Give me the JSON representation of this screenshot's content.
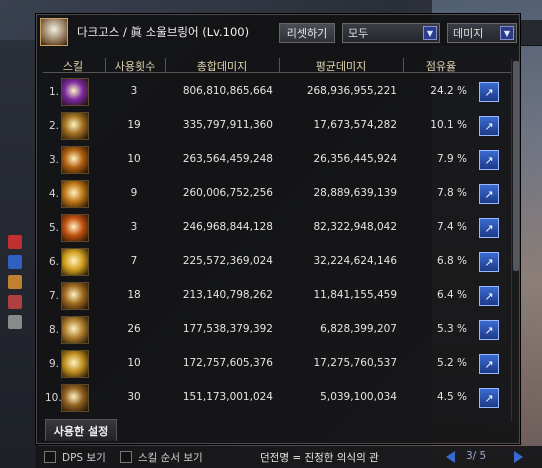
{
  "window": {
    "title": "다크고스 / 眞 소울브링어 (Lv.100)",
    "reset_label": "리셋하기",
    "filter_value": "모두",
    "metric_value": "데미지"
  },
  "columns": [
    "스킬",
    "사용횟수",
    "총합데미지",
    "평균데미지",
    "점유율"
  ],
  "rows": [
    {
      "rank": "1.",
      "uses": "3",
      "total": "806,810,865,664",
      "avg": "268,936,955,221",
      "share": "24.2 %",
      "icon": "skill-purple-burst-icon",
      "color": "#7a2aa0"
    },
    {
      "rank": "2.",
      "uses": "19",
      "total": "335,797,911,360",
      "avg": "17,673,574,282",
      "share": "10.1 %",
      "icon": "skill-gold-swirl-icon",
      "color": "#a07020"
    },
    {
      "rank": "3.",
      "uses": "10",
      "total": "263,564,459,248",
      "avg": "26,356,445,924",
      "share": "7.9 %",
      "icon": "skill-flame-wave-icon",
      "color": "#b06010"
    },
    {
      "rank": "4.",
      "uses": "9",
      "total": "260,006,752,256",
      "avg": "28,889,639,139",
      "share": "7.8 %",
      "icon": "skill-arc-slash-icon",
      "color": "#c07818"
    },
    {
      "rank": "5.",
      "uses": "3",
      "total": "246,968,844,128",
      "avg": "82,322,948,042",
      "share": "7.4 %",
      "icon": "skill-fire-blade-icon",
      "color": "#c05010"
    },
    {
      "rank": "6.",
      "uses": "7",
      "total": "225,572,369,024",
      "avg": "32,224,624,146",
      "share": "6.8 %",
      "icon": "skill-star-burst-icon",
      "color": "#d0a020"
    },
    {
      "rank": "7.",
      "uses": "18",
      "total": "213,140,798,262",
      "avg": "11,841,155,459",
      "share": "6.4 %",
      "icon": "skill-cross-slash-icon",
      "color": "#a06a20"
    },
    {
      "rank": "8.",
      "uses": "26",
      "total": "177,538,379,392",
      "avg": "6,828,399,207",
      "share": "5.3 %",
      "icon": "skill-spear-dash-icon",
      "color": "#b08030"
    },
    {
      "rank": "9.",
      "uses": "10",
      "total": "172,757,605,376",
      "avg": "17,275,760,537",
      "share": "5.2 %",
      "icon": "skill-blade-rush-icon",
      "color": "#c09020"
    },
    {
      "rank": "10.",
      "uses": "30",
      "total": "151,173,001,024",
      "avg": "5,039,100,034",
      "share": "4.5 %",
      "icon": "skill-ring-slash-icon",
      "color": "#906020"
    }
  ],
  "footer": {
    "tab_label": "사용한 설정",
    "dps_label": "DPS 보기",
    "skill_order_label": "스킬 순서 보기",
    "dungeon_text": "던전명 = 진정한 의식의 관",
    "page_text": "3/ 5"
  }
}
